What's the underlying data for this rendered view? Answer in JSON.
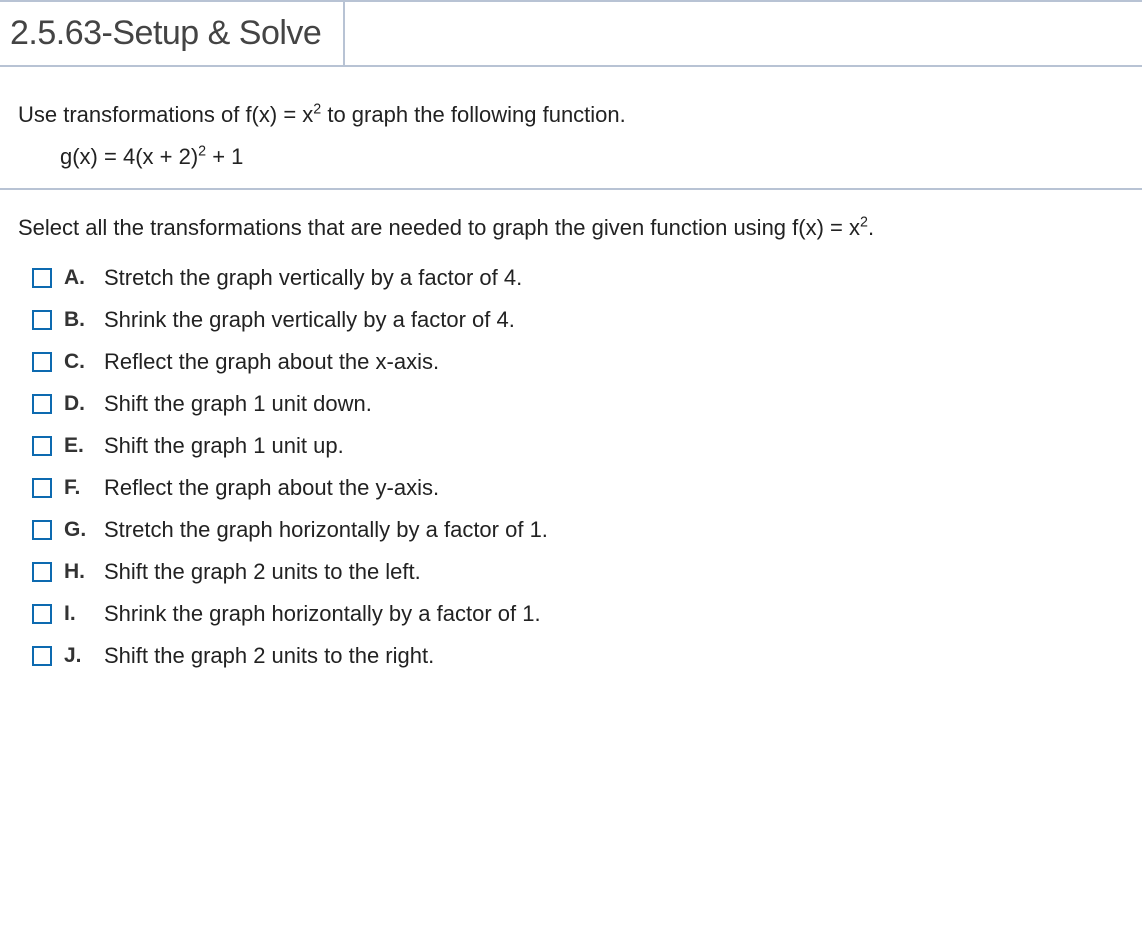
{
  "header": {
    "title": "2.5.63-Setup & Solve"
  },
  "prompt": {
    "pre": "Use transformations of ",
    "fx_lhs": "f(x) = x",
    "fx_exp": "2",
    "post": " to graph the following function."
  },
  "equation": {
    "g_pre": "g(x) = 4(x + 2)",
    "g_exp": "2",
    "g_post": " + 1"
  },
  "subprompt": {
    "pre": "Select all the transformations that are needed to graph the given function using ",
    "fx_lhs": "f(x) = x",
    "fx_exp": "2",
    "post": "."
  },
  "options": [
    {
      "letter": "A.",
      "text": "Stretch the graph vertically by a factor of 4."
    },
    {
      "letter": "B.",
      "text": "Shrink the graph vertically by a factor of 4."
    },
    {
      "letter": "C.",
      "text": "Reflect the graph about the x-axis."
    },
    {
      "letter": "D.",
      "text": "Shift the graph 1 unit down."
    },
    {
      "letter": "E.",
      "text": "Shift the graph 1 unit up."
    },
    {
      "letter": "F.",
      "text": "Reflect the graph about the y-axis."
    },
    {
      "letter": "G.",
      "text": "Stretch the graph horizontally by a factor of 1."
    },
    {
      "letter": "H.",
      "text": "Shift the graph 2 units to the left."
    },
    {
      "letter": "I.",
      "text": "Shrink the graph horizontally by a factor of 1."
    },
    {
      "letter": "J.",
      "text": "Shift the graph 2 units to the right."
    }
  ]
}
